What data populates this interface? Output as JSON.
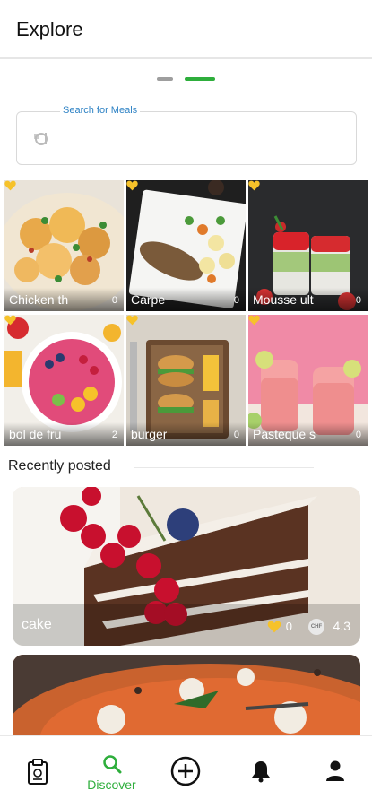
{
  "header": {
    "title": "Explore"
  },
  "search": {
    "label": "Search for Meals"
  },
  "grid": [
    {
      "title": "Chicken th",
      "likes": "0"
    },
    {
      "title": "Carpe",
      "likes": "0"
    },
    {
      "title": "Mousse ult",
      "likes": "0"
    },
    {
      "title": "bol de fru",
      "likes": "2"
    },
    {
      "title": "burger",
      "likes": "0"
    },
    {
      "title": "Pasteque s",
      "likes": "0"
    }
  ],
  "recent": {
    "heading": "Recently posted",
    "cards": [
      {
        "title": "cake",
        "likes": "0",
        "badge": "CHF",
        "rating": "4.3"
      }
    ]
  },
  "nav": {
    "items": [
      {
        "icon": "recipe-clipboard-icon",
        "label": ""
      },
      {
        "icon": "search-icon",
        "label": "Discover"
      },
      {
        "icon": "add-circle-icon",
        "label": ""
      },
      {
        "icon": "bell-icon",
        "label": ""
      },
      {
        "icon": "person-icon",
        "label": ""
      }
    ]
  },
  "colors": {
    "accent": "#2eae3c",
    "heart": "#f6c22a",
    "label_blue": "#2f83c5"
  }
}
